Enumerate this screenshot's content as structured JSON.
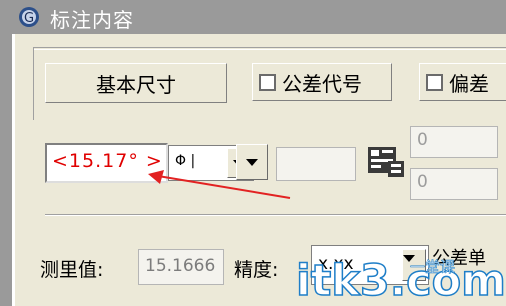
{
  "window": {
    "title": "标注内容"
  },
  "tabs": [
    {
      "label": "基本尺寸",
      "checkbox": false
    },
    {
      "label": "公差代号",
      "checkbox": true,
      "checked": false
    },
    {
      "label": "偏差",
      "checkbox": true,
      "checked": false
    }
  ],
  "main_input": {
    "value": "<15.17° >",
    "color": "#e00000"
  },
  "symbol_combo": {
    "value": "Φ |"
  },
  "tolerance": {
    "upper": "0",
    "lower": "0"
  },
  "measure": {
    "label": "测里值:",
    "value": "15.1666"
  },
  "precision": {
    "label": "精度:",
    "value": "x.xx"
  },
  "unit": {
    "label": "公差单"
  },
  "watermark": {
    "text": "itk3.com",
    "sub": "一堂课"
  },
  "colors": {
    "arrow": "#e22222",
    "watermark": "#1e7ec8",
    "background": "#ece9d8"
  }
}
